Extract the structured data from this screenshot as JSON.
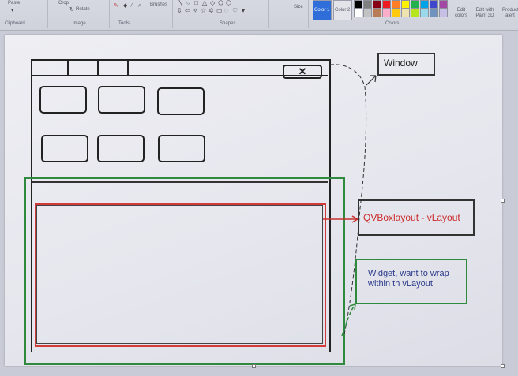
{
  "ribbon": {
    "paste_label": "Paste",
    "crop_label": "Crop",
    "rotate_label": "Rotate",
    "brushes_label": "Brushes",
    "size_label": "Size",
    "color1_label": "Color 1",
    "color2_label": "Color 2",
    "edit_colors_label": "Edit colors",
    "paint3d_label": "Edit with Paint 3D",
    "product_label": "Product alert",
    "groups": {
      "clipboard": "Clipboard",
      "image": "Image",
      "tools": "Tools",
      "shapes": "Shapes",
      "colors": "Colors"
    },
    "palette": [
      "#000000",
      "#7f7f7f",
      "#880015",
      "#ed1c24",
      "#ff7f27",
      "#fff200",
      "#22b14c",
      "#00a2e8",
      "#3f48cc",
      "#a349a4",
      "#ffffff",
      "#c3c3c3",
      "#b97a57",
      "#ffaec9",
      "#ffc90e",
      "#efe4b0",
      "#b5e61d",
      "#99d9ea",
      "#7092be",
      "#c8bfe7"
    ]
  },
  "sketch": {
    "window_label": "Window",
    "qvbox_label": "QVBoxlayout  - vLayout",
    "widget_label": "Widget,   want to wrap within th vLayout",
    "close_glyph": "✕",
    "colors": {
      "ink": "#222222",
      "green": "#2f8a3e",
      "red": "#d33b3b"
    }
  }
}
